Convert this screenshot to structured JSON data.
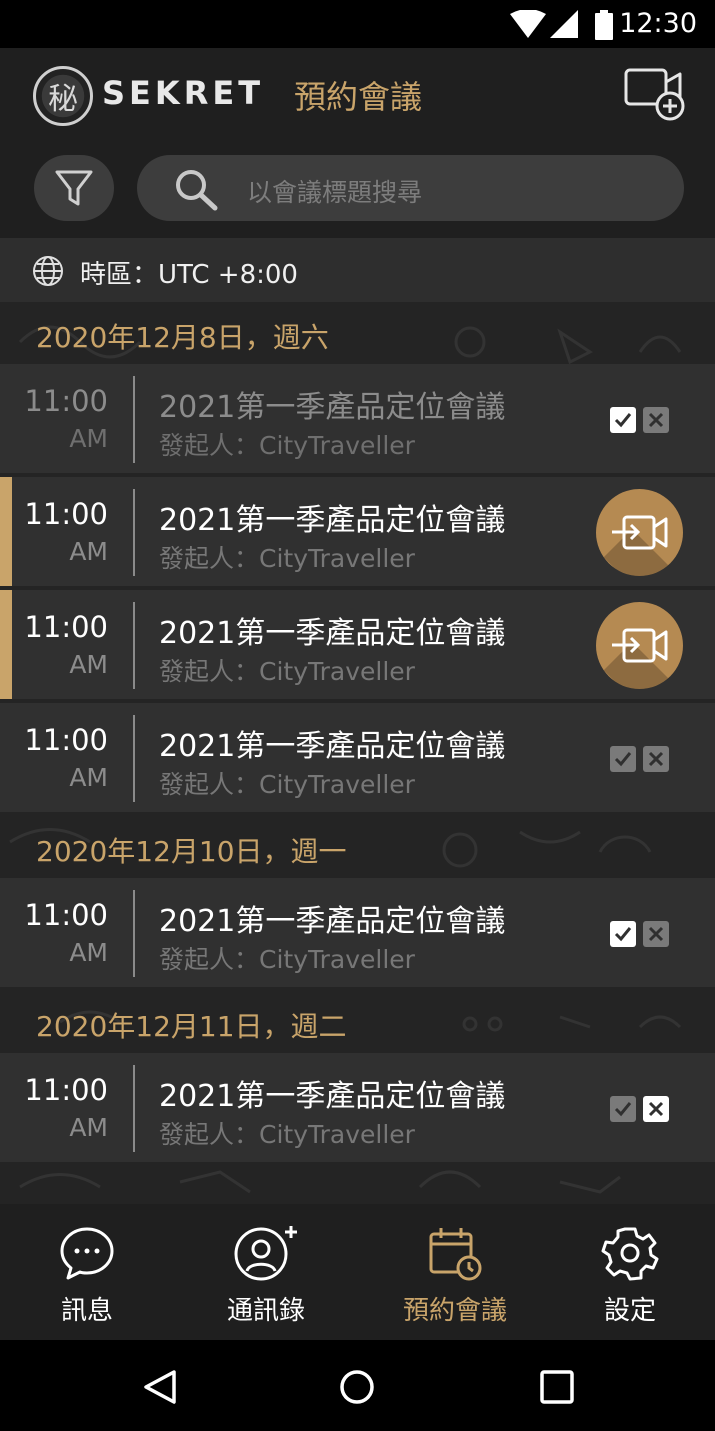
{
  "status_bar": {
    "time": "12:30"
  },
  "app_bar": {
    "brand": "SEKRET",
    "logo_glyph": "秘",
    "title": "預約會議",
    "new_meeting_icon": "video-plus-icon"
  },
  "search": {
    "placeholder": "以會議標題搜尋"
  },
  "timezone": {
    "label": "時區：UTC +8:00"
  },
  "sections": [
    {
      "date": "2020年12月8日，週六",
      "meetings": [
        {
          "time": "11:00",
          "ampm": "AM",
          "title": "2021第一季產品定位會議",
          "host": "發起人：CityTraveller",
          "state": "past",
          "accepted": true,
          "declined": false
        },
        {
          "time": "11:00",
          "ampm": "AM",
          "title": "2021第一季產品定位會議",
          "host": "發起人：CityTraveller",
          "state": "ongoing",
          "action": "join-icon"
        },
        {
          "time": "11:00",
          "ampm": "AM",
          "title": "2021第一季產品定位會議",
          "host": "發起人：CityTraveller",
          "state": "ongoing",
          "action": "join-icon"
        },
        {
          "time": "11:00",
          "ampm": "AM",
          "title": "2021第一季產品定位會議",
          "host": "發起人：CityTraveller",
          "state": "pending",
          "accepted": false,
          "declined": false
        }
      ]
    },
    {
      "date": "2020年12月10日，週一",
      "meetings": [
        {
          "time": "11:00",
          "ampm": "AM",
          "title": "2021第一季產品定位會議",
          "host": "發起人：CityTraveller",
          "state": "accepted",
          "accepted": true,
          "declined": false
        }
      ]
    },
    {
      "date": "2020年12月11日，週二",
      "meetings": [
        {
          "time": "11:00",
          "ampm": "AM",
          "title": "2021第一季產品定位會議",
          "host": "發起人：CityTraveller",
          "state": "declined",
          "accepted": false,
          "declined": true
        }
      ]
    }
  ],
  "bottom_nav": [
    {
      "label": "訊息",
      "icon": "chat-icon",
      "active": false
    },
    {
      "label": "通訊錄",
      "icon": "add-contact-icon",
      "active": false
    },
    {
      "label": "預約會議",
      "icon": "calendar-clock-icon",
      "active": true
    },
    {
      "label": "設定",
      "icon": "gear-icon",
      "active": false
    }
  ],
  "colors": {
    "accent": "#c9a46a",
    "join_button": "#b58a52",
    "background": "#242424",
    "row": "#303030",
    "bar": "#1f1f1f"
  }
}
